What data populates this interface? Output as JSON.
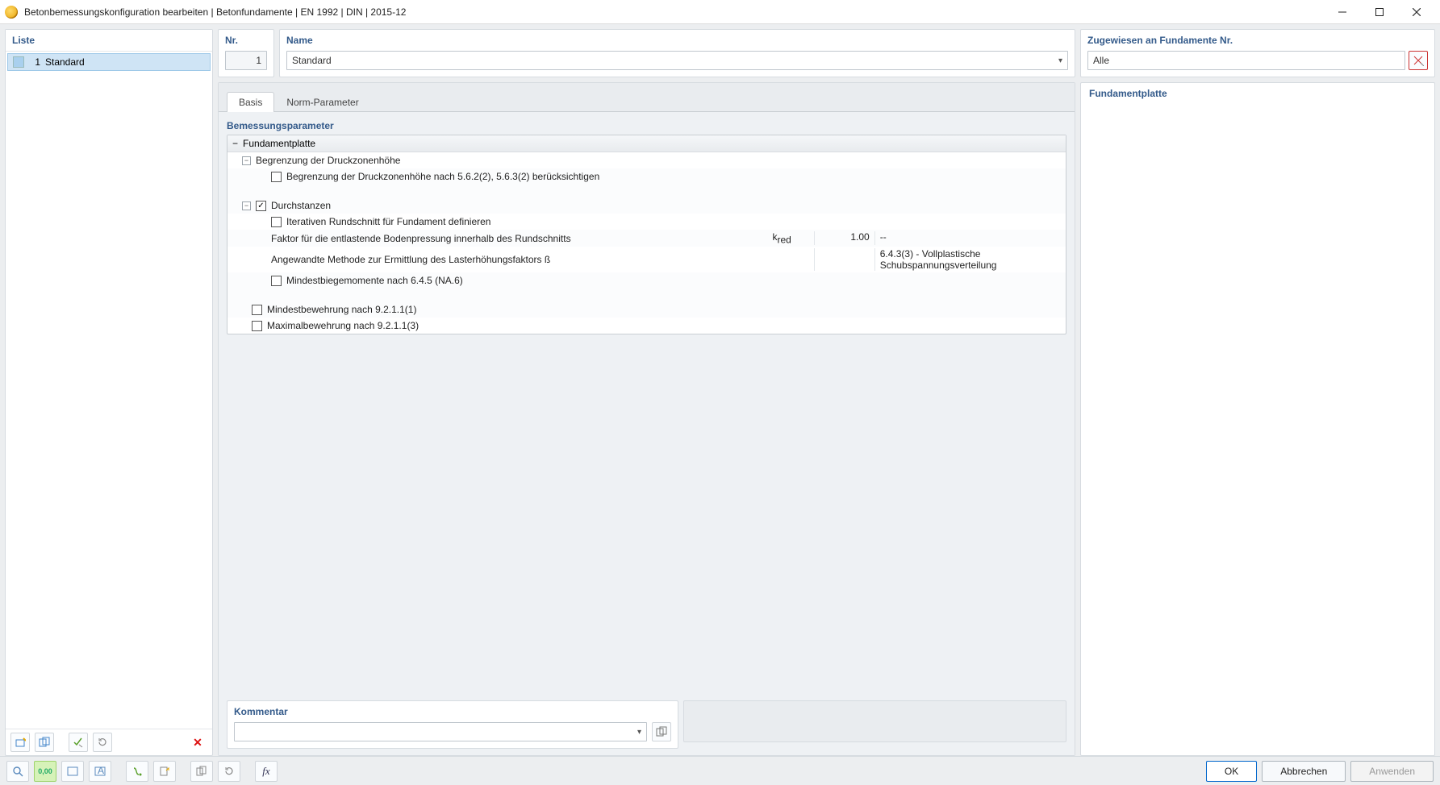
{
  "titlebar": {
    "title": "Betonbemessungskonfiguration bearbeiten | Betonfundamente | EN 1992 | DIN | 2015-12"
  },
  "left": {
    "title": "Liste",
    "items": [
      {
        "num": "1",
        "label": "Standard"
      }
    ]
  },
  "header_fields": {
    "nr_label": "Nr.",
    "nr_value": "1",
    "name_label": "Name",
    "name_value": "Standard"
  },
  "assign": {
    "label": "Zugewiesen an Fundamente Nr.",
    "value": "Alle"
  },
  "tabs": {
    "basis": "Basis",
    "norm": "Norm-Parameter"
  },
  "params": {
    "title": "Bemessungsparameter",
    "root": "Fundamentplatte",
    "g1": {
      "label": "Begrenzung der Druckzonenhöhe",
      "c1": "Begrenzung der Druckzonenhöhe nach 5.6.2(2), 5.6.3(2) berücksichtigen"
    },
    "g2": {
      "label": "Durchstanzen",
      "c1": "Iterativen Rundschnitt für Fundament definieren",
      "row_factor": {
        "label": "Faktor für die entlastende Bodenpressung innerhalb des Rundschnitts",
        "sym": "k",
        "sub": "red",
        "val": "1.00",
        "unit": "--"
      },
      "row_method": {
        "label": "Angewandte Methode zur Ermittlung des Lasterhöhungsfaktors ß",
        "val": "6.4.3(3) - Vollplastische Schubspannungsverteilung"
      },
      "c2": "Mindestbiegemomente nach 6.4.5 (NA.6)"
    },
    "c_min": "Mindestbewehrung nach 9.2.1.1(1)",
    "c_max": "Maximalbewehrung nach 9.2.1.1(3)"
  },
  "kommentar_label": "Kommentar",
  "right_panel_title": "Fundamentplatte",
  "buttons": {
    "ok": "OK",
    "cancel": "Abbrechen",
    "apply": "Anwenden"
  },
  "bottom_icons": {
    "units": "0,00"
  }
}
